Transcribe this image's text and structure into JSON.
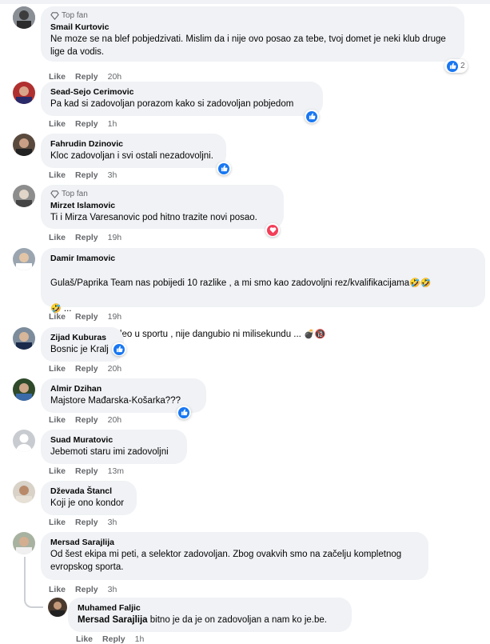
{
  "labels": {
    "like": "Like",
    "reply": "Reply",
    "top_fan": "Top fan"
  },
  "colors": {
    "accent": "#1877f2",
    "love": "#f33e58",
    "bubble": "#f0f2f5",
    "meta": "#65676b"
  },
  "comments": [
    {
      "name": "Smail Kurtovic",
      "top_fan": true,
      "text": "Ne moze se na blef pobjedzivati. Mislim da i nije ovo posao za tebe, tvoj domet je neki klub druge lige da vodis.",
      "time": "20h",
      "reaction": "like",
      "reaction_count": "2"
    },
    {
      "name": "Sead-Sejo Cerimovic",
      "text": "Pa kad si zadovoljan porazom kako si zadovoljan pobjedom",
      "time": "1h",
      "reaction": "like"
    },
    {
      "name": "Fahrudin Dzinovic",
      "text": "Kloc zadovoljan i svi ostali nezadovoljni.",
      "time": "3h",
      "reaction": "like"
    },
    {
      "name": "Mirzet Islamovic",
      "top_fan": true,
      "text": "Ti i Mirza Varesanovic pod hitno trazite novi posao.",
      "time": "19h",
      "reaction": "love"
    },
    {
      "name": "Damir Imamovic",
      "text_line1": "Gulaš/Paprika Team nas pobijedi 10 razlike , a mi smo kao zadovoljni rez/kvalifikacijama",
      "text_line2": "...",
      "text_line3": "Fakat ko nas je kleo u sportu , nije dangubio ni milisekundu ...",
      "emoji_laugh": "🤣",
      "emoji_bomb": "💣",
      "emoji_18": "🔞",
      "time": "19h"
    },
    {
      "name": "Zijad Kuburas",
      "text": "Bosnic je Kralj",
      "time": "20h",
      "reaction": "like"
    },
    {
      "name": "Almir Dzihan",
      "text": "Majstore Mađarska-Košarka???",
      "time": "20h",
      "reaction": "like"
    },
    {
      "name": "Suad Muratovic",
      "text": "Jebemoti staru imi zadovoljni",
      "time": "13m"
    },
    {
      "name": "Dževada Štancl",
      "text": "Koji je ono kondor",
      "time": "3h"
    },
    {
      "name": "Mersad Sarajlija",
      "text": "Od šest ekipa mi peti, a selektor zadovoljan. Zbog ovakvih smo na začelju kompletnog evropskog sporta.",
      "time": "3h"
    }
  ],
  "reply": {
    "name": "Muhamed Faljic",
    "mention": "Mersad Sarajlija",
    "text": " bitno je da je on zadovoljan a nam ko je.be.",
    "time": "1h"
  }
}
